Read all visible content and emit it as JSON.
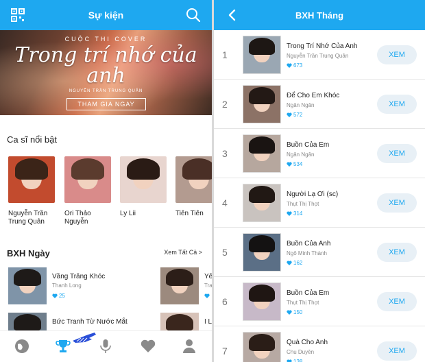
{
  "left": {
    "header": {
      "title": "Sự kiện"
    },
    "banner": {
      "subtitle": "CUỘC THI COVER",
      "script_title": "Trong trí nhớ của anh",
      "artist": "NGUYỄN TRẦN TRUNG QUÂN",
      "cta": "THAM GIA NGAY"
    },
    "featured": {
      "title": "Ca sĩ nổi bật",
      "singers": [
        {
          "name": "Nguyễn Trần Trung Quân"
        },
        {
          "name": "Ori Thảo Nguyễn"
        },
        {
          "name": "Ly Lii"
        },
        {
          "name": "Tiên Tiên"
        }
      ]
    },
    "daily": {
      "title": "BXH Ngày",
      "see_all": "Xem Tất Cả >",
      "rows": [
        {
          "title": "Vầng Trăng Khóc",
          "artist": "Thanh Long",
          "likes": "25",
          "title2": "Yê",
          "artist2": "Tra",
          "likes2": ""
        },
        {
          "title": "Bức Tranh Từ Nước Mắt",
          "artist": "",
          "likes": "",
          "title2": "I L",
          "artist2": "",
          "likes2": ""
        }
      ]
    },
    "tabs": [
      "explore",
      "ranking",
      "record",
      "favorites",
      "profile"
    ]
  },
  "right": {
    "header": {
      "title": "BXH Tháng"
    },
    "button_label": "XEM",
    "rows": [
      {
        "rank": "1",
        "title": "Trong Trí Nhớ Của Anh",
        "artist": "Nguyễn Trần Trung Quân",
        "likes": "673"
      },
      {
        "rank": "2",
        "title": "Để Cho Em Khóc",
        "artist": "Ngân Ngân",
        "likes": "572"
      },
      {
        "rank": "3",
        "title": "Buồn Của Em",
        "artist": "Ngân Ngân",
        "likes": "534"
      },
      {
        "rank": "4",
        "title": "Người Lạ Ơi (sc)",
        "artist": "Thụt Thị Thọt",
        "likes": "314"
      },
      {
        "rank": "5",
        "title": "Buồn Của Anh",
        "artist": "Ngô Minh Thành",
        "likes": "162"
      },
      {
        "rank": "6",
        "title": "Buồn Của Em",
        "artist": "Thụt Thị Thọt",
        "likes": "150"
      },
      {
        "rank": "7",
        "title": "Quà Cho Anh",
        "artist": "Chu Duyên",
        "likes": "138"
      }
    ]
  },
  "colors": {
    "accent": "#1ea8f0",
    "button_bg": "#e8f0f6"
  }
}
